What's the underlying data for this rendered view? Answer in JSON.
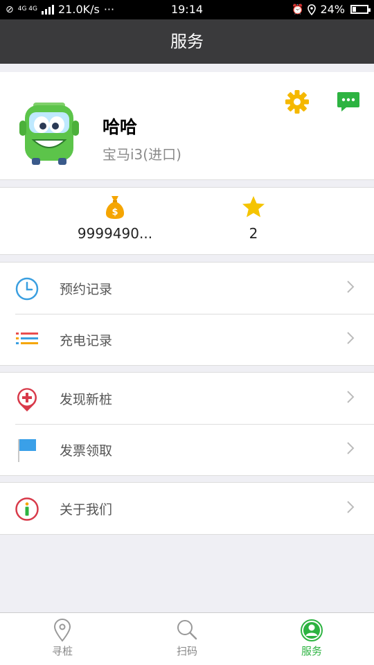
{
  "status_bar": {
    "network_type": "4G 4G",
    "speed": "21.0K/s",
    "more": "···",
    "time": "19:14",
    "battery": "24%",
    "battery_level": 0.24
  },
  "header": {
    "title": "服务"
  },
  "profile": {
    "username": "哈哈",
    "car_model": "宝马i3(进口)"
  },
  "stats": {
    "balance": "9999490...",
    "favorites": "2"
  },
  "menu": {
    "group1": [
      {
        "label": "预约记录",
        "icon": "clock-icon"
      },
      {
        "label": "充电记录",
        "icon": "list-icon"
      }
    ],
    "group2": [
      {
        "label": "发现新桩",
        "icon": "location-plus-icon"
      },
      {
        "label": "发票领取",
        "icon": "flag-icon"
      }
    ],
    "group3": [
      {
        "label": "关于我们",
        "icon": "info-icon"
      }
    ]
  },
  "bottom_nav": [
    {
      "label": "寻桩",
      "icon": "location-icon",
      "active": false
    },
    {
      "label": "扫码",
      "icon": "search-icon",
      "active": false
    },
    {
      "label": "服务",
      "icon": "user-icon",
      "active": true
    }
  ],
  "colors": {
    "active": "#2db341",
    "header_bg": "#3a3a3c",
    "accent_yellow": "#f5b800"
  }
}
